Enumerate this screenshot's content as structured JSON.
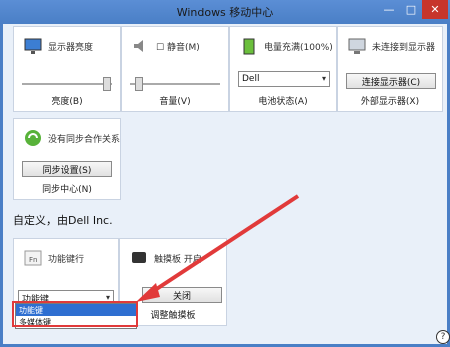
{
  "window": {
    "title": "Windows 移动中心",
    "min": "—",
    "max": "□",
    "close": "✕"
  },
  "tiles": {
    "brightness": {
      "heading": "显示器亮度",
      "label": "亮度(B)",
      "level": 0.9
    },
    "volume": {
      "checkbox": "静音(M)",
      "label": "音量(V)",
      "level": 0.05
    },
    "battery": {
      "heading": "电量充满(100%)",
      "select": "Dell",
      "label": "电池状态(A)"
    },
    "display": {
      "heading": "未连接到显示器",
      "button": "连接显示器(C)",
      "label": "外部显示器(X)"
    },
    "sync": {
      "heading": "没有同步合作关系",
      "button": "同步设置(S)",
      "label": "同步中心(N)"
    }
  },
  "custom_section": {
    "text": "自定义，由Dell Inc."
  },
  "custom_tiles": {
    "fn": {
      "heading": "功能键行",
      "select": "功能键",
      "options": [
        "功能键",
        "多媒体键"
      ],
      "selected_index": 0
    },
    "touchpad": {
      "heading": "触摸板 开启",
      "button": "关闭",
      "label": "调整触摸板"
    }
  },
  "help": "?",
  "colors": {
    "accent": "#4a7fc6",
    "highlight": "#2f6fd1",
    "annotation": "#e13a3a"
  }
}
